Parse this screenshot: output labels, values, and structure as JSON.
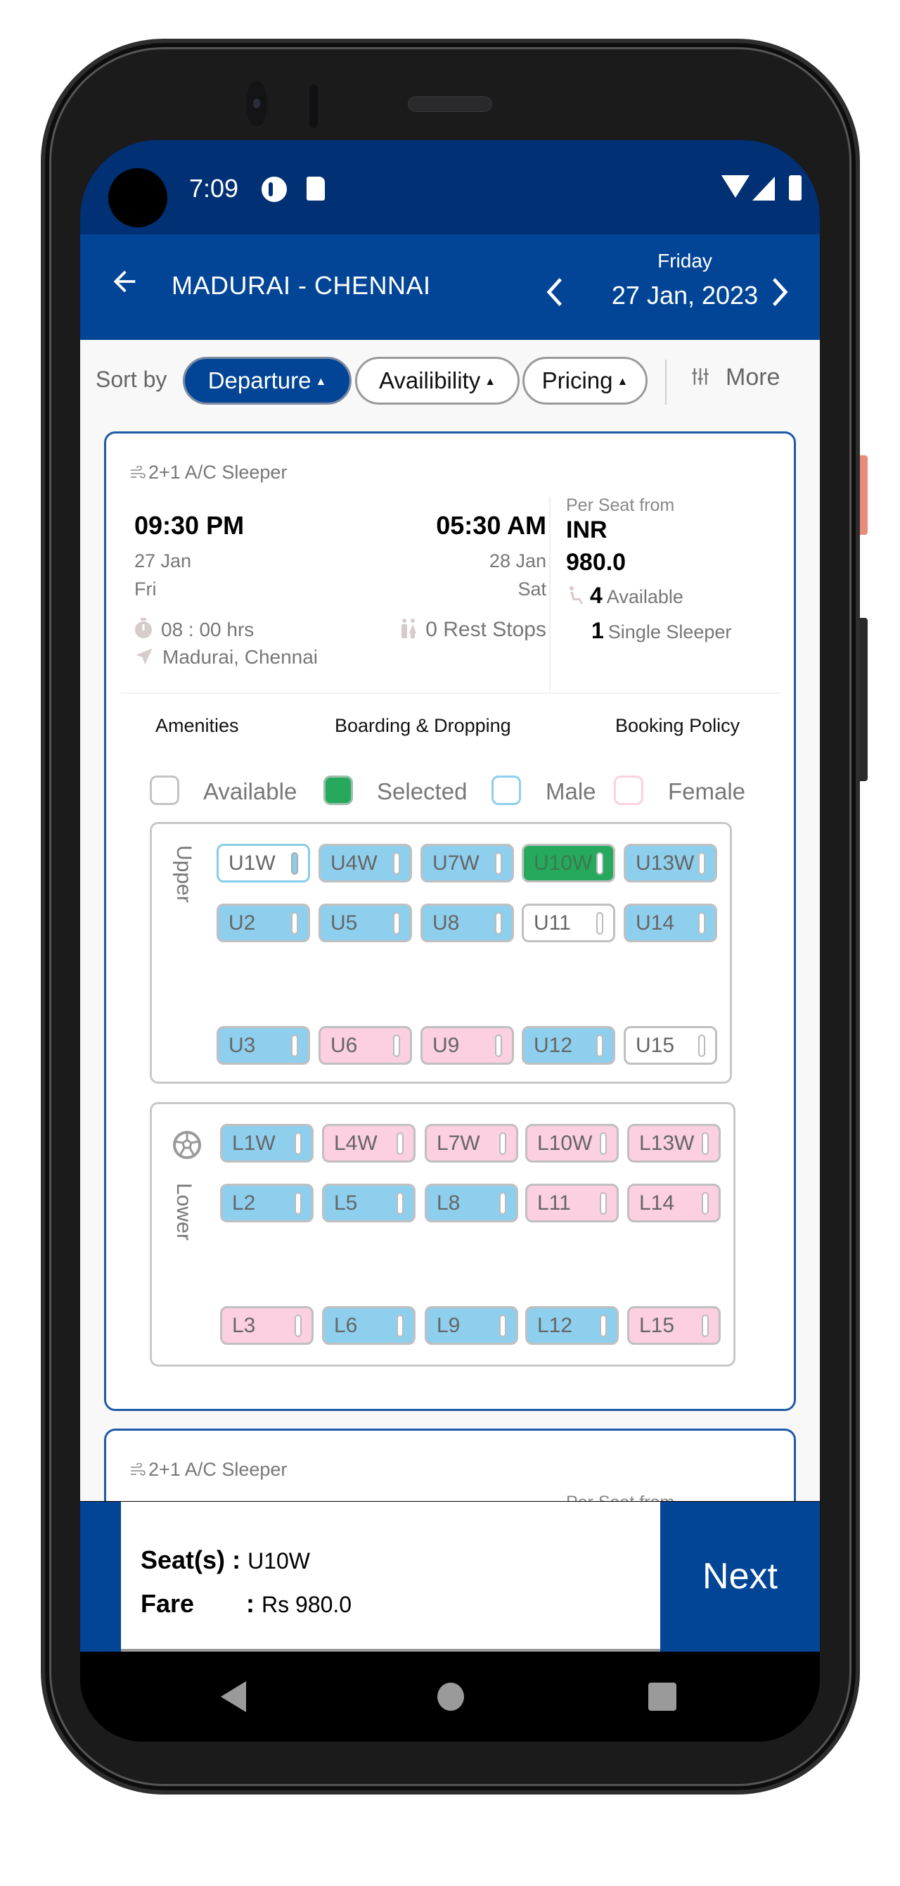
{
  "status_bar": {
    "time": "7:09"
  },
  "app_bar": {
    "title": "MADURAI - CHENNAI",
    "day": "Friday",
    "date": "27 Jan, 2023",
    "back_icon": "arrow-left-icon",
    "prev_icon": "chevron-left-icon",
    "next_icon": "chevron-right-icon"
  },
  "sort": {
    "label": "Sort by",
    "options": [
      {
        "label": "Departure",
        "active": true
      },
      {
        "label": "Availibility",
        "active": false
      },
      {
        "label": "Pricing",
        "active": false
      }
    ],
    "caret": "▲",
    "more_label": "More"
  },
  "buses": [
    {
      "type": "2+1 A/C Sleeper",
      "departure": {
        "time": "09:30 PM",
        "date": "27 Jan",
        "day": "Fri"
      },
      "arrival": {
        "time": "05:30 AM",
        "date": "28 Jan",
        "day": "Sat"
      },
      "duration": "08 : 00 hrs",
      "rest_stops": "0 Rest Stops",
      "places": "Madurai, Chennai",
      "per_seat_label": "Per Seat from",
      "currency": "INR",
      "price": "980.0",
      "available_count": "4",
      "available_label": "Available",
      "single_count": "1",
      "single_label": "Single Sleeper",
      "tabs": [
        "Amenities",
        "Boarding & Dropping",
        "Booking Policy"
      ]
    },
    {
      "type": "2+1 A/C Sleeper",
      "per_seat_label": "Per Seat from"
    }
  ],
  "legend": [
    {
      "label": "Available",
      "key": "available"
    },
    {
      "label": "Selected",
      "key": "selected"
    },
    {
      "label": "Male",
      "key": "male"
    },
    {
      "label": "Female",
      "key": "female"
    }
  ],
  "colors": {
    "primary": "#024597",
    "status_bar": "#013174",
    "selected": "#26a95c",
    "male": "#8ecfee",
    "female": "#fccfe1"
  },
  "decks": {
    "upper": {
      "label": "Upper",
      "rows": [
        [
          {
            "id": "U1W",
            "state": "available-male"
          },
          {
            "id": "U4W",
            "state": "male"
          },
          {
            "id": "U7W",
            "state": "male"
          },
          {
            "id": "U10W",
            "state": "selected"
          },
          {
            "id": "U13W",
            "state": "male"
          }
        ],
        [
          {
            "id": "U2",
            "state": "male"
          },
          {
            "id": "U5",
            "state": "male"
          },
          {
            "id": "U8",
            "state": "male"
          },
          {
            "id": "U11",
            "state": "available"
          },
          {
            "id": "U14",
            "state": "male"
          }
        ],
        [
          {
            "id": "U3",
            "state": "male"
          },
          {
            "id": "U6",
            "state": "female"
          },
          {
            "id": "U9",
            "state": "female"
          },
          {
            "id": "U12",
            "state": "male"
          },
          {
            "id": "U15",
            "state": "available"
          }
        ]
      ]
    },
    "lower": {
      "label": "Lower",
      "rows": [
        [
          {
            "id": "L1W",
            "state": "male"
          },
          {
            "id": "L4W",
            "state": "female"
          },
          {
            "id": "L7W",
            "state": "female"
          },
          {
            "id": "L10W",
            "state": "female"
          },
          {
            "id": "L13W",
            "state": "female"
          }
        ],
        [
          {
            "id": "L2",
            "state": "male"
          },
          {
            "id": "L5",
            "state": "male"
          },
          {
            "id": "L8",
            "state": "male"
          },
          {
            "id": "L11",
            "state": "female"
          },
          {
            "id": "L14",
            "state": "female"
          }
        ],
        [
          {
            "id": "L3",
            "state": "female"
          },
          {
            "id": "L6",
            "state": "male"
          },
          {
            "id": "L9",
            "state": "male"
          },
          {
            "id": "L12",
            "state": "male"
          },
          {
            "id": "L15",
            "state": "female"
          }
        ]
      ]
    }
  },
  "summary": {
    "seats_label": "Seat(s)",
    "seats_value": "U10W",
    "fare_label": "Fare",
    "fare_value": "Rs 980.0",
    "separator": ":",
    "next_label": "Next"
  }
}
